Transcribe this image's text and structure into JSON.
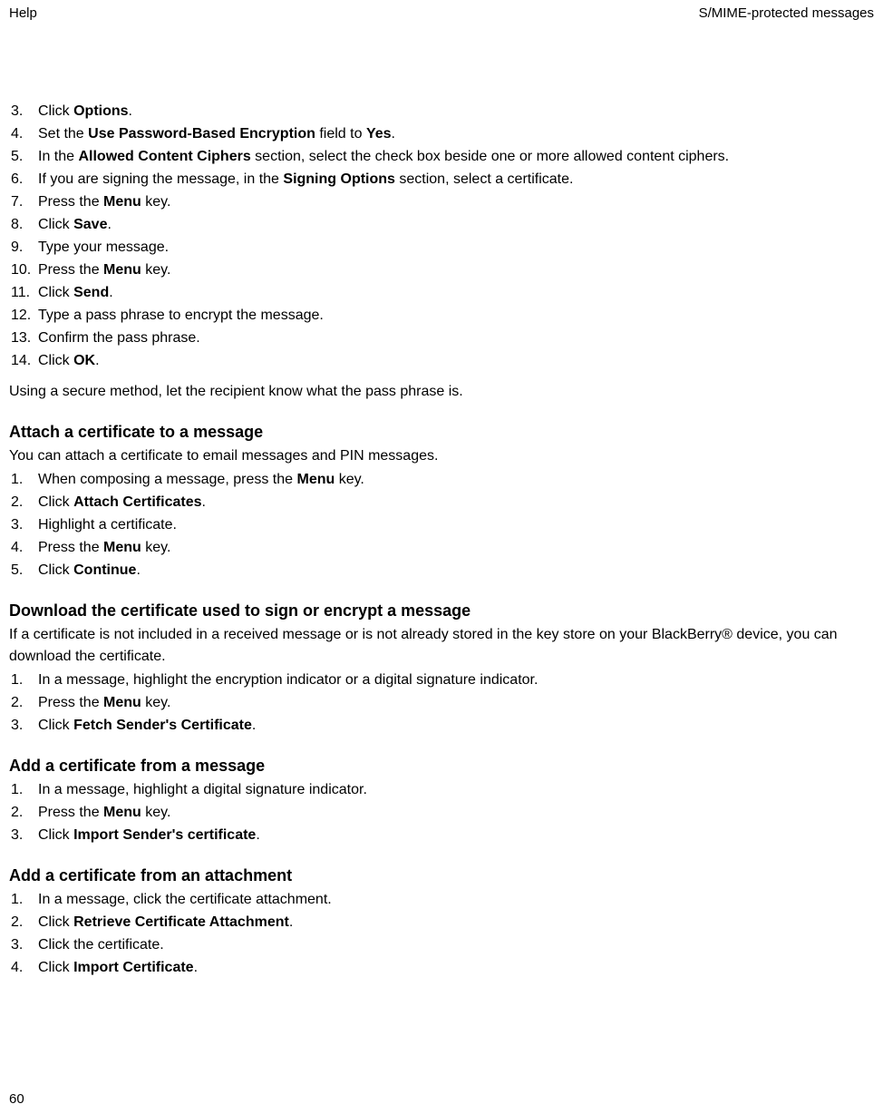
{
  "header": {
    "left": "Help",
    "right": "S/MIME-protected messages"
  },
  "list1": {
    "items": [
      {
        "num": "3.",
        "parts": [
          [
            "Click ",
            false
          ],
          [
            "Options",
            true
          ],
          [
            ".",
            false
          ]
        ]
      },
      {
        "num": "4.",
        "parts": [
          [
            "Set the ",
            false
          ],
          [
            "Use Password-Based Encryption",
            true
          ],
          [
            " field to ",
            false
          ],
          [
            "Yes",
            true
          ],
          [
            ".",
            false
          ]
        ]
      },
      {
        "num": "5.",
        "parts": [
          [
            "In the ",
            false
          ],
          [
            "Allowed Content Ciphers",
            true
          ],
          [
            " section, select the check box beside one or more allowed content ciphers.",
            false
          ]
        ]
      },
      {
        "num": "6.",
        "parts": [
          [
            "If you are signing the message, in the ",
            false
          ],
          [
            "Signing Options",
            true
          ],
          [
            " section, select a certificate.",
            false
          ]
        ]
      },
      {
        "num": "7.",
        "parts": [
          [
            "Press the ",
            false
          ],
          [
            "Menu",
            true
          ],
          [
            " key.",
            false
          ]
        ]
      },
      {
        "num": "8.",
        "parts": [
          [
            "Click ",
            false
          ],
          [
            "Save",
            true
          ],
          [
            ".",
            false
          ]
        ]
      },
      {
        "num": "9.",
        "parts": [
          [
            "Type your message.",
            false
          ]
        ]
      },
      {
        "num": "10.",
        "parts": [
          [
            "Press the ",
            false
          ],
          [
            "Menu",
            true
          ],
          [
            " key.",
            false
          ]
        ]
      },
      {
        "num": "11.",
        "parts": [
          [
            "Click ",
            false
          ],
          [
            "Send",
            true
          ],
          [
            ".",
            false
          ]
        ]
      },
      {
        "num": "12.",
        "parts": [
          [
            "Type a pass phrase to encrypt the message.",
            false
          ]
        ]
      },
      {
        "num": "13.",
        "parts": [
          [
            "Confirm the pass phrase.",
            false
          ]
        ]
      },
      {
        "num": "14.",
        "parts": [
          [
            "Click ",
            false
          ],
          [
            "OK",
            true
          ],
          [
            ".",
            false
          ]
        ]
      }
    ],
    "after": "Using a secure method, let the recipient know what the pass phrase is."
  },
  "section2": {
    "heading": "Attach a certificate to a message",
    "intro": "You can attach a certificate to email messages and PIN messages.",
    "items": [
      {
        "num": "1.",
        "parts": [
          [
            "When composing a message, press the ",
            false
          ],
          [
            "Menu",
            true
          ],
          [
            " key.",
            false
          ]
        ]
      },
      {
        "num": "2.",
        "parts": [
          [
            "Click ",
            false
          ],
          [
            "Attach Certificates",
            true
          ],
          [
            ".",
            false
          ]
        ]
      },
      {
        "num": "3.",
        "parts": [
          [
            "Highlight a certificate.",
            false
          ]
        ]
      },
      {
        "num": "4.",
        "parts": [
          [
            "Press the ",
            false
          ],
          [
            "Menu",
            true
          ],
          [
            " key.",
            false
          ]
        ]
      },
      {
        "num": "5.",
        "parts": [
          [
            "Click ",
            false
          ],
          [
            "Continue",
            true
          ],
          [
            ".",
            false
          ]
        ]
      }
    ]
  },
  "section3": {
    "heading": "Download the certificate used to sign or encrypt a message",
    "intro": "If a certificate is not included in a received message or is not already stored in the key store on your BlackBerry® device, you can download the certificate.",
    "items": [
      {
        "num": "1.",
        "parts": [
          [
            "In a message, highlight the encryption indicator or a digital signature indicator.",
            false
          ]
        ]
      },
      {
        "num": "2.",
        "parts": [
          [
            "Press the ",
            false
          ],
          [
            "Menu",
            true
          ],
          [
            " key.",
            false
          ]
        ]
      },
      {
        "num": "3.",
        "parts": [
          [
            "Click ",
            false
          ],
          [
            "Fetch Sender's Certificate",
            true
          ],
          [
            ".",
            false
          ]
        ]
      }
    ]
  },
  "section4": {
    "heading": "Add a certificate from a message",
    "items": [
      {
        "num": "1.",
        "parts": [
          [
            "In a message, highlight a digital signature indicator.",
            false
          ]
        ]
      },
      {
        "num": "2.",
        "parts": [
          [
            "Press the ",
            false
          ],
          [
            "Menu",
            true
          ],
          [
            " key.",
            false
          ]
        ]
      },
      {
        "num": "3.",
        "parts": [
          [
            "Click ",
            false
          ],
          [
            "Import Sender's certificate",
            true
          ],
          [
            ".",
            false
          ]
        ]
      }
    ]
  },
  "section5": {
    "heading": "Add a certificate from an attachment",
    "items": [
      {
        "num": "1.",
        "parts": [
          [
            "In a message, click the certificate attachment.",
            false
          ]
        ]
      },
      {
        "num": "2.",
        "parts": [
          [
            "Click ",
            false
          ],
          [
            "Retrieve Certificate Attachment",
            true
          ],
          [
            ".",
            false
          ]
        ]
      },
      {
        "num": "3.",
        "parts": [
          [
            "Click the certificate.",
            false
          ]
        ]
      },
      {
        "num": "4.",
        "parts": [
          [
            "Click ",
            false
          ],
          [
            "Import Certificate",
            true
          ],
          [
            ".",
            false
          ]
        ]
      }
    ]
  },
  "pageNumber": "60"
}
